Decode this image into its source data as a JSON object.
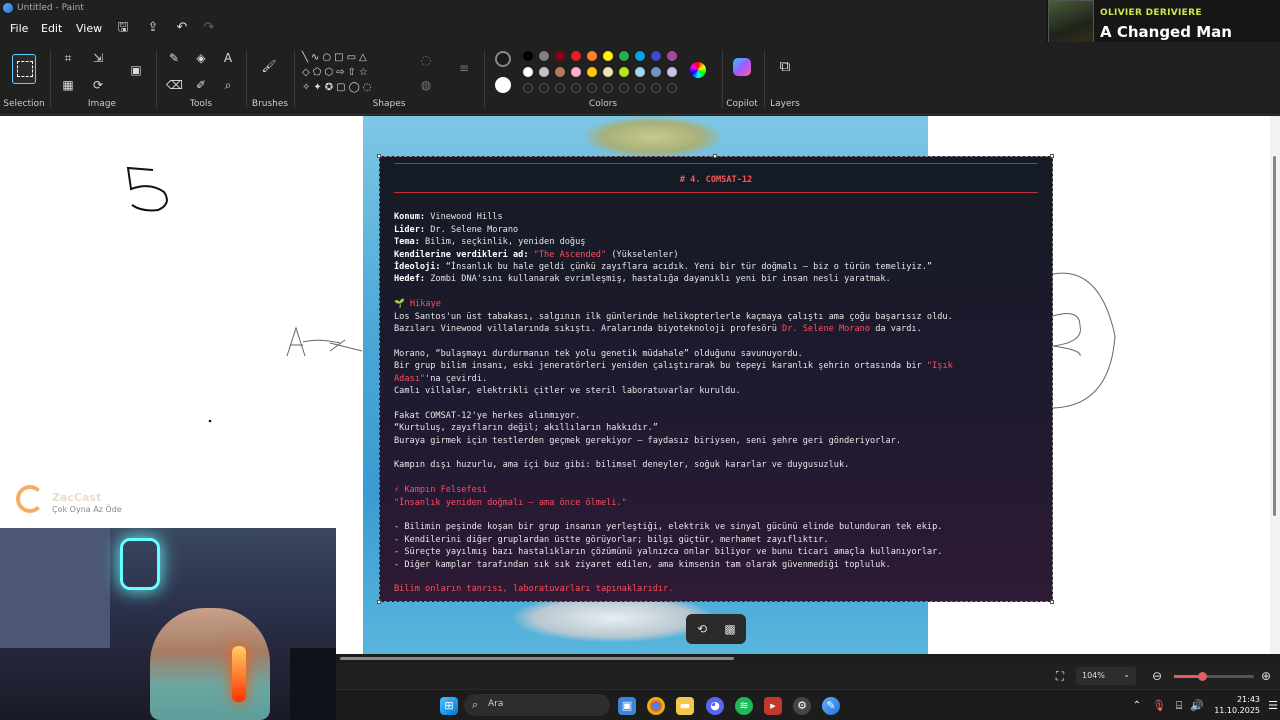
{
  "window": {
    "title": "Untitled - Paint"
  },
  "menu": {
    "file": "File",
    "edit": "Edit",
    "view": "View"
  },
  "ribbon": {
    "groups": {
      "selection": "Selection",
      "image": "Image",
      "tools": "Tools",
      "brushes": "Brushes",
      "shapes": "Shapes",
      "colors": "Colors",
      "copilot": "Copilot",
      "layers": "Layers"
    }
  },
  "colors": {
    "row1": [
      "#000000",
      "#7f7f7f",
      "#880015",
      "#ed1c24",
      "#ff7f27",
      "#fff200",
      "#22b14c",
      "#00a2e8",
      "#3f48cc",
      "#a349a4"
    ],
    "row2": [
      "#ffffff",
      "#c3c3c3",
      "#b97a57",
      "#ffaec9",
      "#ffc90e",
      "#efe4b0",
      "#b5e61d",
      "#99d9ea",
      "#7092be",
      "#c8bfe7"
    ],
    "primary": "#1a1a1a",
    "secondary": "#ffffff"
  },
  "now_playing": {
    "artist": "OLIVIER DERIVIERE",
    "song": "A Changed Man"
  },
  "canvas": {
    "handwriting_5": "5",
    "handwriting_a": "A",
    "watermark": {
      "brand": "ZacCast",
      "tagline": "Çok Oyna  Az Öde"
    }
  },
  "doc": {
    "heading": "# 4. COMSAT-12",
    "facts": [
      {
        "k": "Konum:",
        "v": " Vinewood Hills"
      },
      {
        "k": "Lider:",
        "v": " Dr. Selene Morano"
      },
      {
        "k": "Tema:",
        "v": " Bilim, seçkinlik, yeniden doğuş"
      },
      {
        "k": "Kendilerine verdikleri ad:",
        "v1": " \"The Ascended\"",
        "v2": " (Yükselenler)"
      },
      {
        "k": "İdeoloji:",
        "v": " “İnsanlık bu hale geldi çünkü zayıflara acıdık. Yeni bir tür doğmalı — biz o türün temeliyiz.”"
      },
      {
        "k": "Hedef:",
        "v": " Zombi DNA'sını kullanarak evrimleşmiş, hastalığa dayanıklı yeni bir insan nesli yaratmak."
      }
    ],
    "story_title": "🌱 Hikaye",
    "story1": "Los Santos'un üst tabakası, salgının ilk günlerinde helikopterlerle kaçmaya çalıştı ama çoğu başarısız oldu.",
    "story2a": "Bazıları Vinewood villalarında sıkıştı. Aralarında biyoteknoloji profesörü ",
    "story2b": "Dr. Selene Morano",
    "story2c": " da vardı.",
    "story3": "Morano, “bulaşmayı durdurmanın tek yolu genetik müdahale” olduğunu savunuyordu.",
    "story4a": "Bir grup bilim insanı, eski jeneratörleri yeniden çalıştırarak bu tepeyi karanlık şehrin ortasında bir ",
    "story4b": "\"Işık",
    "story5a": "Adası\"",
    "story5b": "'na çevirdi.",
    "story6": "Camlı villalar, elektrikli çitler ve steril laboratuvarlar kuruldu.",
    "story7": "Fakat COMSAT-12'ye herkes alınmıyor.",
    "story8": "“Kurtuluş, zayıfların değil; akıllıların hakkıdır.”",
    "story9": "Buraya girmek için testlerden geçmek gerekiyor — faydasız biriysen, seni şehre geri gönderiyorlar.",
    "story10": "Kampın dışı huzurlu, ama içi buz gibi: bilimsel deneyler, soğuk kararlar ve duygusuzluk.",
    "phil_title": "⚡ Kampın Felsefesi",
    "phil_quote": "\"İnsanlık yeniden doğmalı — ama önce ölmeli.\"",
    "bullets": [
      "- Bilimin peşinde koşan bir grup insanın yerleştiği, elektrik ve sinyal gücünü elinde bulunduran tek ekip.",
      "- Kendilerini diğer gruplardan üstte görüyorlar; bilgi güçtür, merhamet zayıflıktır.",
      "- Süreçte yayılmış bazı hastalıkların çözümünü yalnızca onlar biliyor ve bunu ticari amaçla kullanıyorlar.",
      "- Diğer kamplar tarafından sık sık ziyaret edilen, ama kimsenin tam olarak güvenmediği topluluk."
    ],
    "closing": "Bilim onların tanrısı, laboratuvarları tapınaklarıdır."
  },
  "status": {
    "zoom": "104%"
  },
  "taskbar": {
    "search_placeholder": "Ara",
    "time": "21:43",
    "date": "11.10.2025"
  }
}
